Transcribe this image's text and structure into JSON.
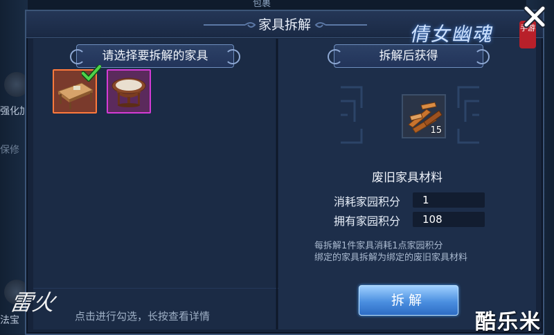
{
  "background": {
    "top_label": "包裹",
    "side_labels": [
      "强化加",
      "保修",
      "法宝"
    ]
  },
  "dialog": {
    "title": "家具拆解",
    "logo_text": "倩女幽魂",
    "logo_seal": "手游"
  },
  "left_panel": {
    "banner": "请选择要拆解的家具",
    "items": [
      {
        "name": "wooden-table",
        "quality": "orange",
        "selected": true
      },
      {
        "name": "round-table",
        "quality": "purple",
        "selected": false
      }
    ],
    "hint": "点击进行勾选，长按查看详情",
    "brand_mark": "雷火"
  },
  "right_panel": {
    "banner": "拆解后获得",
    "result_item": {
      "icon": "wood-material-icon",
      "count": "15"
    },
    "result_name": "废旧家具材料",
    "stats": [
      {
        "label": "消耗家园积分",
        "value": "1"
      },
      {
        "label": "拥有家园积分",
        "value": "108"
      }
    ],
    "notes": [
      "每拆解1件家具消耗1点家园积分",
      "绑定的家具拆解为绑定的废旧家具材料"
    ],
    "confirm_label": "拆解"
  },
  "watermark": "酷乐米",
  "colors": {
    "orange_quality": "#ff7a3d",
    "purple_quality": "#d63bd6",
    "button_blue": "#4b8fe0"
  }
}
